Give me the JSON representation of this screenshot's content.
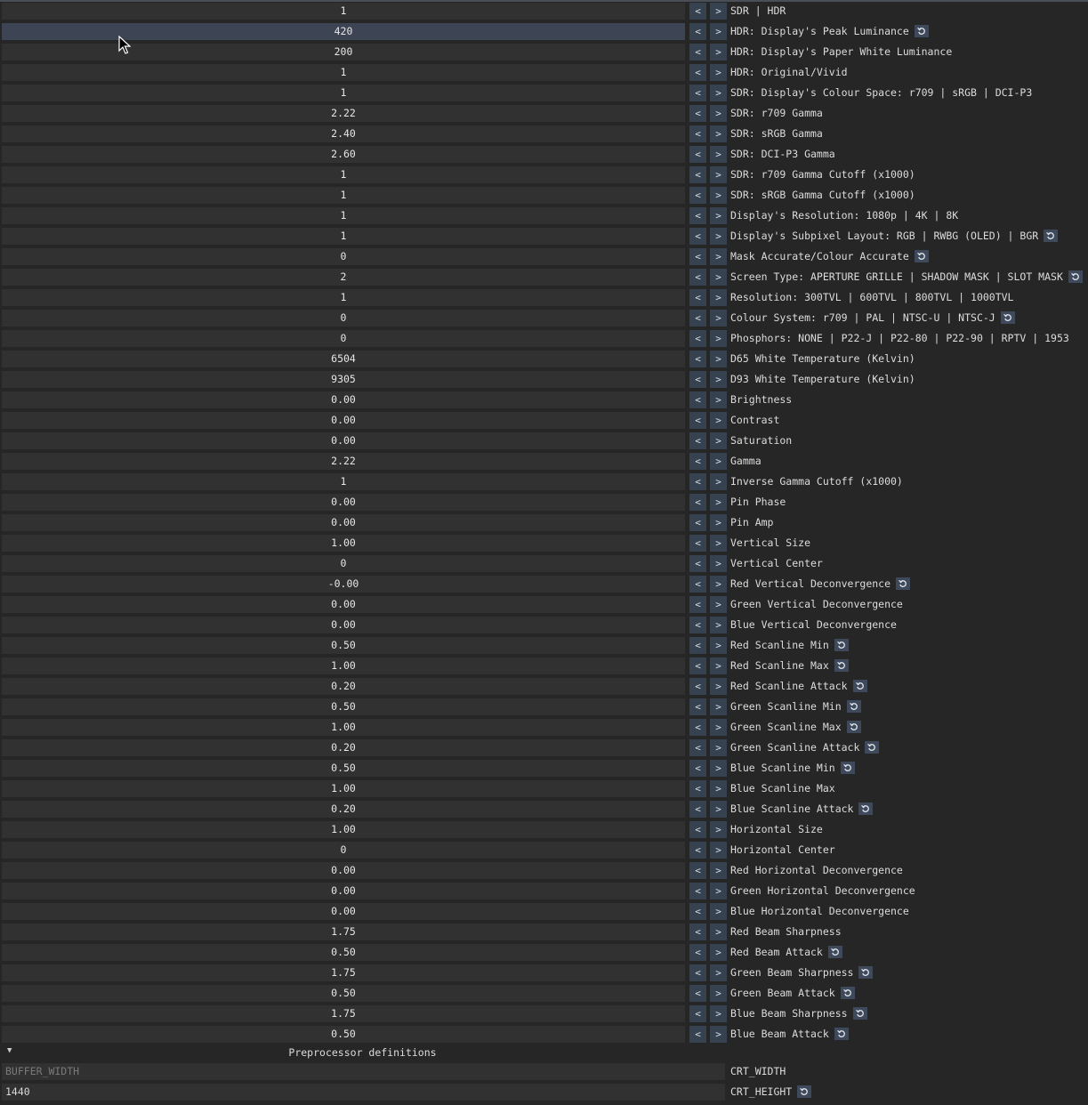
{
  "controls": {
    "decrement_label": "<",
    "increment_label": ">"
  },
  "settings": [
    {
      "value": "1",
      "label": "SDR | HDR",
      "reset": false
    },
    {
      "value": "420",
      "label": "HDR: Display's Peak Luminance",
      "reset": true
    },
    {
      "value": "200",
      "label": "HDR: Display's Paper White Luminance",
      "reset": false
    },
    {
      "value": "1",
      "label": "HDR: Original/Vivid",
      "reset": false
    },
    {
      "value": "1",
      "label": "SDR: Display's Colour Space: r709 | sRGB | DCI-P3",
      "reset": false
    },
    {
      "value": "2.22",
      "label": "SDR: r709 Gamma",
      "reset": false
    },
    {
      "value": "2.40",
      "label": "SDR: sRGB Gamma",
      "reset": false
    },
    {
      "value": "2.60",
      "label": "SDR: DCI-P3 Gamma",
      "reset": false
    },
    {
      "value": "1",
      "label": "SDR: r709 Gamma Cutoff (x1000)",
      "reset": false
    },
    {
      "value": "1",
      "label": "SDR: sRGB Gamma Cutoff (x1000)",
      "reset": false
    },
    {
      "value": "1",
      "label": "Display's Resolution: 1080p | 4K | 8K",
      "reset": false
    },
    {
      "value": "1",
      "label": "Display's Subpixel Layout: RGB | RWBG (OLED) | BGR",
      "reset": true
    },
    {
      "value": "0",
      "label": "Mask Accurate/Colour Accurate",
      "reset": true
    },
    {
      "value": "2",
      "label": "Screen Type: APERTURE GRILLE | SHADOW MASK | SLOT MASK",
      "reset": true
    },
    {
      "value": "1",
      "label": "Resolution: 300TVL | 600TVL | 800TVL | 1000TVL",
      "reset": false
    },
    {
      "value": "0",
      "label": "Colour System: r709 | PAL | NTSC-U | NTSC-J",
      "reset": true
    },
    {
      "value": "0",
      "label": "Phosphors: NONE | P22-J | P22-80 | P22-90 | RPTV | 1953",
      "reset": false
    },
    {
      "value": "6504",
      "label": "D65 White Temperature (Kelvin)",
      "reset": false
    },
    {
      "value": "9305",
      "label": "D93 White Temperature (Kelvin)",
      "reset": false
    },
    {
      "value": "0.00",
      "label": "Brightness",
      "reset": false
    },
    {
      "value": "0.00",
      "label": "Contrast",
      "reset": false
    },
    {
      "value": "0.00",
      "label": "Saturation",
      "reset": false
    },
    {
      "value": "2.22",
      "label": "Gamma",
      "reset": false
    },
    {
      "value": "1",
      "label": "Inverse Gamma Cutoff (x1000)",
      "reset": false
    },
    {
      "value": "0.00",
      "label": "Pin Phase",
      "reset": false
    },
    {
      "value": "0.00",
      "label": "Pin Amp",
      "reset": false
    },
    {
      "value": "1.00",
      "label": "Vertical Size",
      "reset": false
    },
    {
      "value": "0",
      "label": "Vertical Center",
      "reset": false
    },
    {
      "value": "-0.00",
      "label": "Red Vertical Deconvergence",
      "reset": true
    },
    {
      "value": "0.00",
      "label": "Green Vertical Deconvergence",
      "reset": false
    },
    {
      "value": "0.00",
      "label": "Blue Vertical Deconvergence",
      "reset": false
    },
    {
      "value": "0.50",
      "label": "Red Scanline Min",
      "reset": true
    },
    {
      "value": "1.00",
      "label": "Red Scanline Max",
      "reset": true
    },
    {
      "value": "0.20",
      "label": "Red Scanline Attack",
      "reset": true
    },
    {
      "value": "0.50",
      "label": "Green Scanline Min",
      "reset": true
    },
    {
      "value": "1.00",
      "label": "Green Scanline Max",
      "reset": true
    },
    {
      "value": "0.20",
      "label": "Green Scanline Attack",
      "reset": true
    },
    {
      "value": "0.50",
      "label": "Blue Scanline Min",
      "reset": true
    },
    {
      "value": "1.00",
      "label": "Blue Scanline Max",
      "reset": false
    },
    {
      "value": "0.20",
      "label": "Blue Scanline Attack",
      "reset": true
    },
    {
      "value": "1.00",
      "label": "Horizontal Size",
      "reset": false
    },
    {
      "value": "0",
      "label": "Horizontal Center",
      "reset": false
    },
    {
      "value": "0.00",
      "label": "Red Horizontal Deconvergence",
      "reset": false
    },
    {
      "value": "0.00",
      "label": "Green Horizontal Deconvergence",
      "reset": false
    },
    {
      "value": "0.00",
      "label": "Blue Horizontal Deconvergence",
      "reset": false
    },
    {
      "value": "1.75",
      "label": "Red Beam Sharpness",
      "reset": false
    },
    {
      "value": "0.50",
      "label": "Red Beam Attack",
      "reset": true
    },
    {
      "value": "1.75",
      "label": "Green Beam Sharpness",
      "reset": true
    },
    {
      "value": "0.50",
      "label": "Green Beam Attack",
      "reset": true
    },
    {
      "value": "1.75",
      "label": "Blue Beam Sharpness",
      "reset": true
    },
    {
      "value": "0.50",
      "label": "Blue Beam Attack",
      "reset": true
    }
  ],
  "preprocessor": {
    "header_arrow": "▼",
    "title": "Preprocessor definitions",
    "definitions": [
      {
        "value": "",
        "placeholder": "BUFFER_WIDTH",
        "name": "CRT_WIDTH",
        "reset": false
      },
      {
        "value": "1440",
        "placeholder": "",
        "name": "CRT_HEIGHT",
        "reset": true
      }
    ]
  },
  "state": {
    "hovered_row": 1
  }
}
